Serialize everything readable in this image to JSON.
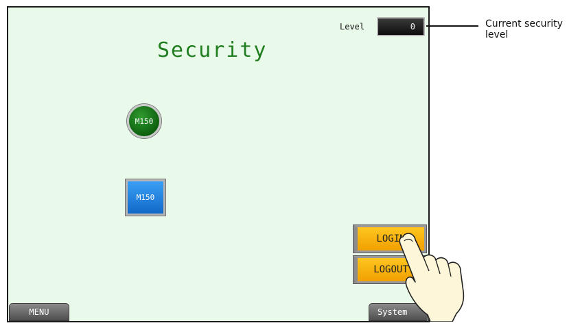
{
  "screen": {
    "title": "Security",
    "level_label": "Level",
    "level_value": "0",
    "lamp_label": "M150",
    "switch_label": "M150",
    "login_label": "LOGIN",
    "logout_label": "LOGOUT",
    "menu_label": "MENU",
    "system_label": "System"
  },
  "callout": {
    "text": "Current security level"
  },
  "colors": {
    "screen_bg": "#eafaea",
    "title": "#1f7d1f",
    "lamp": "#0d5f0d",
    "switch": "#1168c8",
    "button_yellow": "#f0a000"
  },
  "icons": [
    "hand-pointer-icon"
  ]
}
